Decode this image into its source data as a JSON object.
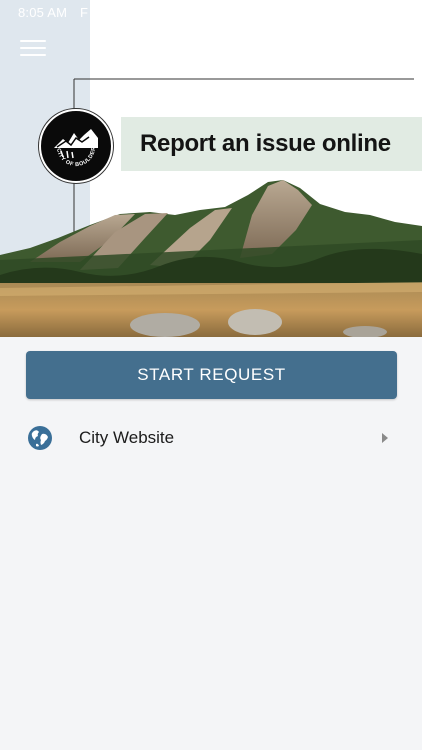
{
  "status_bar": {
    "time": "8:05 AM",
    "extra": "F"
  },
  "header": {
    "menu_icon": "hamburger-menu-icon",
    "logo_icon": "city-of-boulder-logo-icon",
    "logo_text": "CITY OF BOULDER",
    "title": "Report an issue online",
    "hero_image": "flatirons-mountain-photo"
  },
  "actions": {
    "start_request_label": "START REQUEST"
  },
  "links": [
    {
      "icon": "globe-icon",
      "label": "City Website",
      "chevron": "chevron-right-icon"
    }
  ],
  "colors": {
    "primary_button": "#446f8e",
    "title_background": "#e1ebe3",
    "side_panel": "#dfe7ee",
    "globe": "#3a6f98",
    "page_background": "#f4f5f7"
  }
}
